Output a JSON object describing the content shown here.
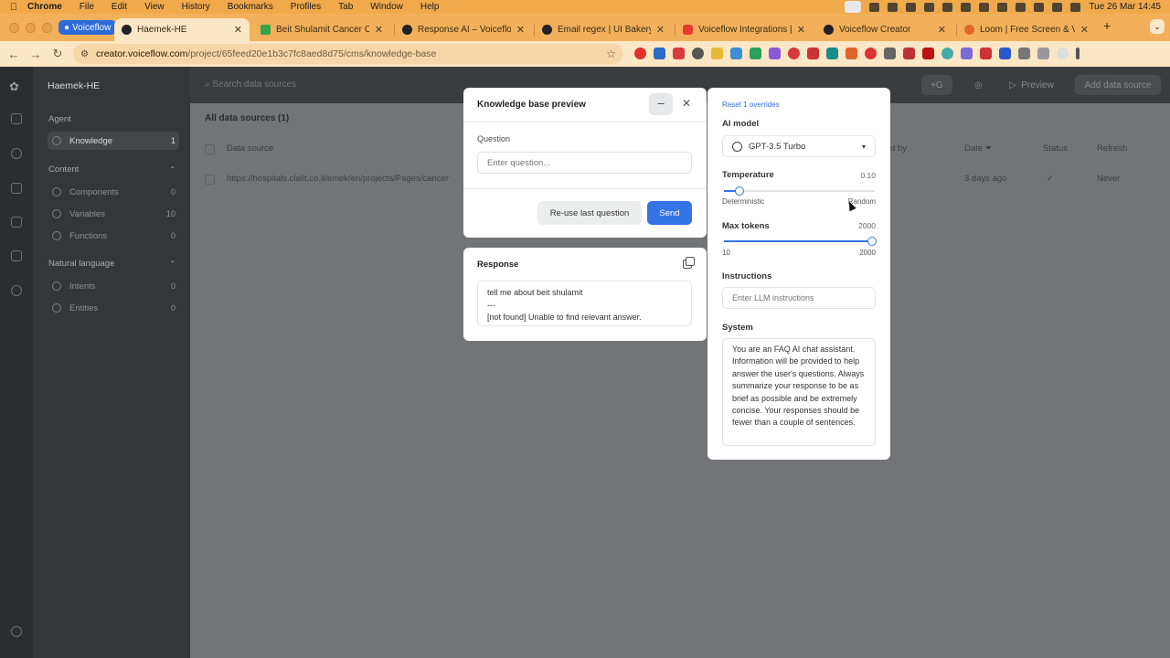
{
  "menubar": {
    "app": "Chrome",
    "items": [
      "File",
      "Edit",
      "View",
      "History",
      "Bookmarks",
      "Profiles",
      "Tab",
      "Window",
      "Help"
    ],
    "datetime": "Tue 26 Mar  14:45"
  },
  "tabs": {
    "group_label": "Voiceflow",
    "items": [
      {
        "title": "Haemek-HE"
      },
      {
        "title": "Beit Shulamit Cancer Cente"
      },
      {
        "title": "Response AI – Voiceflow"
      },
      {
        "title": "Email regex | UI Bakery"
      },
      {
        "title": "Voiceflow Integrations | Co"
      },
      {
        "title": "Voiceflow Creator"
      },
      {
        "title": "Loom | Free Screen & Video"
      }
    ]
  },
  "addressbar": {
    "host": "creator.voiceflow.com",
    "path": "/project/65feed20e1b3c7fc8aed8d75/cms/knowledge-base"
  },
  "sidebar": {
    "project": "Haemek-HE",
    "agent_label": "Agent",
    "knowledge_label": "Knowledge",
    "knowledge_count": "1",
    "content_label": "Content",
    "content_items": [
      {
        "label": "Components",
        "count": "0"
      },
      {
        "label": "Variables",
        "count": "10"
      },
      {
        "label": "Functions",
        "count": "0"
      }
    ],
    "nl_label": "Natural language",
    "nl_items": [
      {
        "label": "Intents",
        "count": "0"
      },
      {
        "label": "Entities",
        "count": "0"
      }
    ]
  },
  "topbar": {
    "search_placeholder": "Search data sources",
    "avatar_letter": "G",
    "preview_label": "Preview",
    "add_label": "Add data source"
  },
  "list": {
    "heading": "All data sources (1)",
    "columns": {
      "source": "Data source",
      "updated_by": "d by",
      "date": "Date",
      "status": "Status",
      "refresh": "Refresh"
    },
    "row": {
      "url": "https://hospitals.clalit.co.il/emek/en/projects/Pages/cancer",
      "date": "3 days ago",
      "refresh": "Never"
    }
  },
  "preview": {
    "title": "Knowledge base preview",
    "question_label": "Question",
    "question_placeholder": "Enter question...",
    "reuse_label": "Re-use last question",
    "send_label": "Send",
    "response_title": "Response",
    "response_lines": [
      "tell me about beit shulamit",
      "---",
      "[not found] Unable to find relevant answer."
    ]
  },
  "settings": {
    "reset_label": "Reset 1 overrides",
    "model_label": "AI model",
    "model_value": "GPT-3.5 Turbo",
    "temperature_label": "Temperature",
    "temperature_value": "0.10",
    "temperature_fraction": 0.1,
    "temp_min_label": "Deterministic",
    "temp_max_label": "Random",
    "max_tokens_label": "Max tokens",
    "max_tokens_value": "2000",
    "tokens_min": "10",
    "tokens_max": "2000",
    "tokens_fraction": 1.0,
    "instructions_label": "Instructions",
    "instructions_placeholder": "Enter LLM instructions",
    "system_label": "System",
    "system_text": "You are an FAQ AI chat assistant. Information will be provided to help answer the user's questions. Always summarize your response to be as brief as possible and be extremely concise. Your responses should be fewer than a couple of sentences."
  },
  "colors": {
    "accent": "#3574e6",
    "tabbar": "#f2b05a",
    "overlay": "#737477"
  }
}
